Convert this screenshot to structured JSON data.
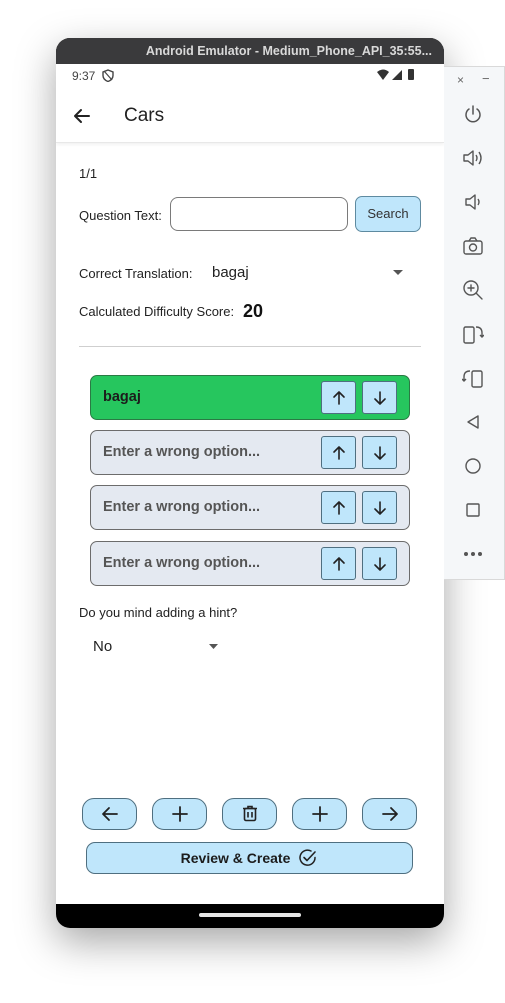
{
  "emulator": {
    "title": "Android Emulator - Medium_Phone_API_35:55..."
  },
  "status_bar": {
    "time": "9:37"
  },
  "app_bar": {
    "title": "Cars"
  },
  "question": {
    "counter": "1/1",
    "text_label": "Question Text:",
    "text_value": "",
    "search_label": "Search",
    "translation_label": "Correct Translation:",
    "translation_value": "bagaj",
    "difficulty_label": "Calculated Difficulty Score:",
    "difficulty_value": "20"
  },
  "options": [
    {
      "text": "bagaj",
      "correct": true
    },
    {
      "placeholder": "Enter a wrong option...",
      "correct": false
    },
    {
      "placeholder": "Enter a wrong option...",
      "correct": false
    },
    {
      "placeholder": "Enter a wrong option...",
      "correct": false
    }
  ],
  "hint": {
    "label": "Do you mind adding a hint?",
    "value": "No"
  },
  "actions": {
    "review_label": "Review & Create"
  },
  "colors": {
    "correct_option": "#26c65e",
    "wrong_option": "#e4e9f1",
    "button_blue": "#bfe6fb"
  },
  "side_toolbar": {
    "icons": [
      "power-icon",
      "volume-up-icon",
      "volume-down-icon",
      "camera-icon",
      "zoom-icon",
      "rotate-right-icon",
      "rotate-left-icon",
      "back-icon",
      "home-icon",
      "overview-icon",
      "more-icon"
    ]
  }
}
